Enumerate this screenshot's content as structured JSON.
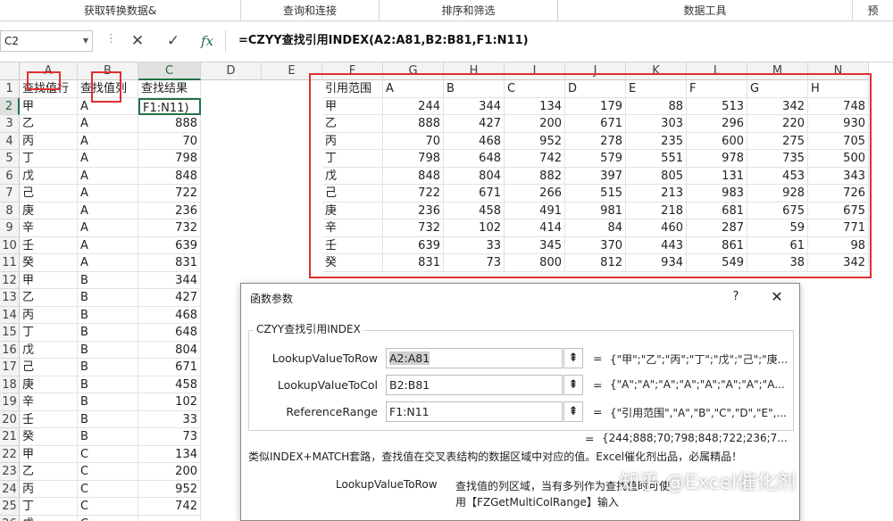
{
  "ribbon": {
    "groups": [
      "获取转换数据&",
      "查询和连接",
      "排序和筛选",
      "数据工具",
      "预"
    ]
  },
  "formula_bar": {
    "name_box": "C2",
    "separator": "⋮",
    "cancel_icon": "✕",
    "enter_icon": "✓",
    "fx_icon": "fx",
    "formula": "=CZYY查找引用INDEX(A2:A81,B2:B81,F1:N11)"
  },
  "columns": [
    "A",
    "B",
    "C",
    "D",
    "E",
    "F",
    "G",
    "H",
    "I",
    "J",
    "K",
    "L",
    "M",
    "N"
  ],
  "rows": [
    "1",
    "2",
    "3",
    "4",
    "5",
    "6",
    "7",
    "8",
    "9",
    "10",
    "11",
    "12",
    "13",
    "14",
    "15",
    "16",
    "17",
    "18",
    "19",
    "20",
    "21",
    "22",
    "23",
    "24",
    "25",
    "26"
  ],
  "sheet_left": {
    "headers": [
      "查找值行",
      "查找值列",
      "查找结果"
    ],
    "rows": [
      [
        "甲",
        "A",
        "F1:N11)"
      ],
      [
        "乙",
        "A",
        "888"
      ],
      [
        "丙",
        "A",
        "70"
      ],
      [
        "丁",
        "A",
        "798"
      ],
      [
        "戊",
        "A",
        "848"
      ],
      [
        "己",
        "A",
        "722"
      ],
      [
        "庚",
        "A",
        "236"
      ],
      [
        "辛",
        "A",
        "732"
      ],
      [
        "壬",
        "A",
        "639"
      ],
      [
        "癸",
        "A",
        "831"
      ],
      [
        "甲",
        "B",
        "344"
      ],
      [
        "乙",
        "B",
        "427"
      ],
      [
        "丙",
        "B",
        "468"
      ],
      [
        "丁",
        "B",
        "648"
      ],
      [
        "戊",
        "B",
        "804"
      ],
      [
        "己",
        "B",
        "671"
      ],
      [
        "庚",
        "B",
        "458"
      ],
      [
        "辛",
        "B",
        "102"
      ],
      [
        "壬",
        "B",
        "33"
      ],
      [
        "癸",
        "B",
        "73"
      ],
      [
        "甲",
        "C",
        "134"
      ],
      [
        "乙",
        "C",
        "200"
      ],
      [
        "丙",
        "C",
        "952"
      ],
      [
        "丁",
        "C",
        "742"
      ],
      [
        "戊",
        "C",
        ""
      ]
    ]
  },
  "ref_table": {
    "headers": [
      "引用范围",
      "A",
      "B",
      "C",
      "D",
      "E",
      "F",
      "G",
      "H"
    ],
    "rows": [
      [
        "甲",
        "244",
        "344",
        "134",
        "179",
        "88",
        "513",
        "342",
        "748"
      ],
      [
        "乙",
        "888",
        "427",
        "200",
        "671",
        "303",
        "296",
        "220",
        "930"
      ],
      [
        "丙",
        "70",
        "468",
        "952",
        "278",
        "235",
        "600",
        "275",
        "705"
      ],
      [
        "丁",
        "798",
        "648",
        "742",
        "579",
        "551",
        "978",
        "735",
        "500"
      ],
      [
        "戊",
        "848",
        "804",
        "882",
        "397",
        "805",
        "131",
        "453",
        "343"
      ],
      [
        "己",
        "722",
        "671",
        "266",
        "515",
        "213",
        "983",
        "928",
        "726"
      ],
      [
        "庚",
        "236",
        "458",
        "491",
        "981",
        "218",
        "681",
        "675",
        "675"
      ],
      [
        "辛",
        "732",
        "102",
        "414",
        "84",
        "460",
        "287",
        "59",
        "771"
      ],
      [
        "壬",
        "639",
        "33",
        "345",
        "370",
        "443",
        "861",
        "61",
        "98"
      ],
      [
        "癸",
        "831",
        "73",
        "800",
        "812",
        "934",
        "549",
        "38",
        "342"
      ]
    ]
  },
  "dialog": {
    "title": "函数参数",
    "help": "?",
    "close": "✕",
    "function_name": "CZYY查找引用INDEX",
    "args": [
      {
        "label": "LookupValueToRow",
        "value": "A2:A81",
        "btn": "⇞",
        "eq": "=",
        "preview": "{\"甲\";\"乙\";\"丙\";\"丁\";\"戊\";\"己\";\"庚..."
      },
      {
        "label": "LookupValueToCol",
        "value": "B2:B81",
        "btn": "⇞",
        "eq": "=",
        "preview": "{\"A\";\"A\";\"A\";\"A\";\"A\";\"A\";\"A\";\"A..."
      },
      {
        "label": "ReferenceRange",
        "value": "F1:N11",
        "btn": "⇞",
        "eq": "=",
        "preview": "{\"引用范围\",\"A\",\"B\",\"C\",\"D\",\"E\",..."
      }
    ],
    "result_eq": "=",
    "result": "{244;888;70;798;848;722;236;7...",
    "description": "类似INDEX+MATCH套路，查找值在交叉表结构的数据区域中对应的值。Excel催化剂出品，必属精品！",
    "arg_name": "LookupValueToRow",
    "arg_desc": "查找值的列区域，当有多列作为查找值时可使用【FZGetMultiColRange】输入"
  },
  "watermark": "知乎 @Excel催化剂"
}
